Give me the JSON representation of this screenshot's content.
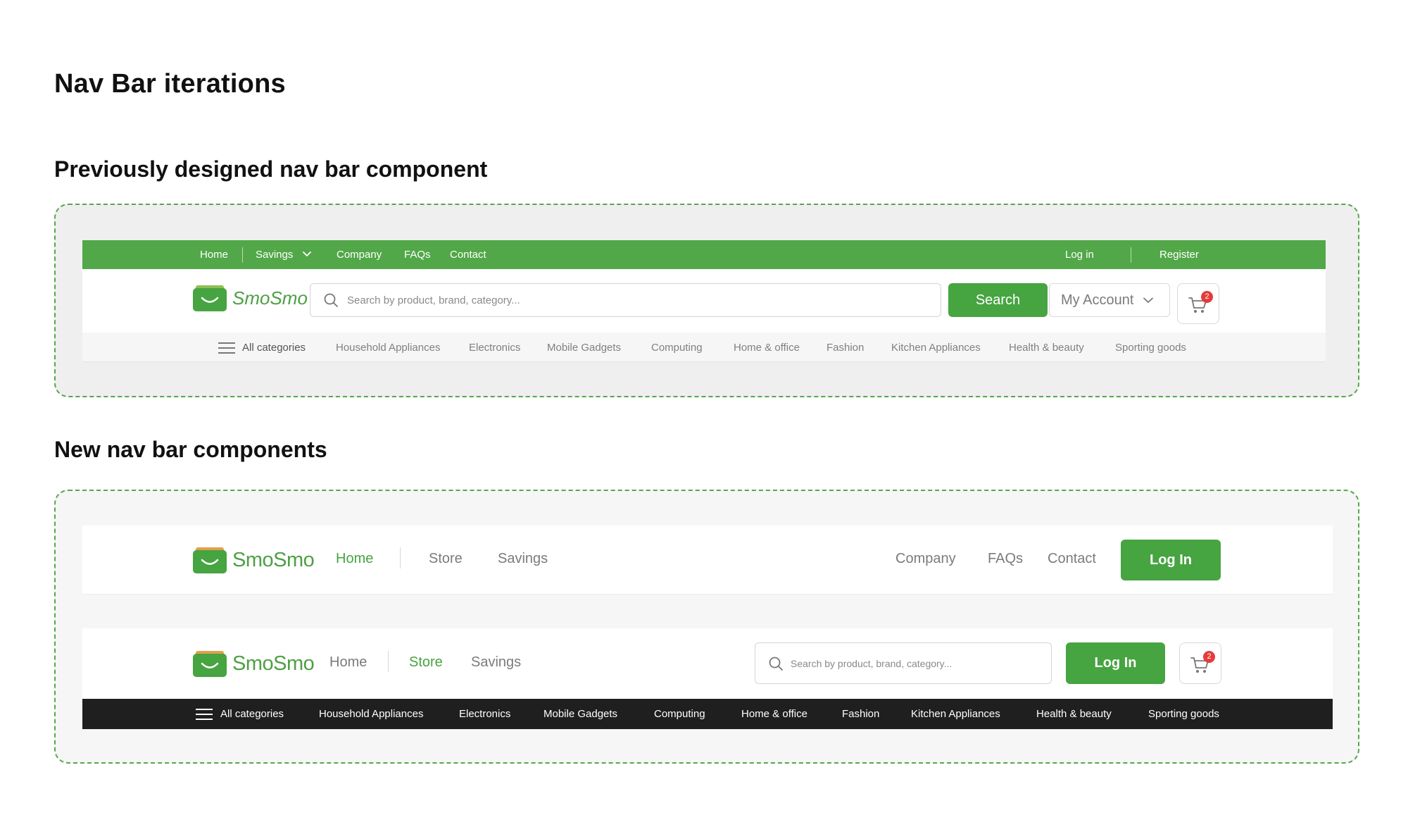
{
  "page": {
    "title": "Nav Bar iterations",
    "section_old": "Previously designed nav bar component",
    "section_new": "New nav bar components"
  },
  "brand": {
    "name": "SmoSmo",
    "color": "#46a441"
  },
  "old_nav": {
    "top_links": [
      "Home",
      "Savings",
      "Company",
      "FAQs",
      "Contact"
    ],
    "login": "Log in",
    "register": "Register",
    "search_placeholder": "Search by product, brand, category...",
    "search_button": "Search",
    "account": "My Account",
    "cart_count": "2",
    "all_categories": "All categories",
    "categories": [
      "Household Appliances",
      "Electronics",
      "Mobile Gadgets",
      "Computing",
      "Home & office",
      "Fashion",
      "Kitchen Appliances",
      "Health & beauty",
      "Sporting goods"
    ]
  },
  "new_nav_a": {
    "left_links": [
      "Home",
      "Store",
      "Savings"
    ],
    "active": "Home",
    "right_links": [
      "Company",
      "FAQs",
      "Contact"
    ],
    "login": "Log In"
  },
  "new_nav_b": {
    "left_links": [
      "Home",
      "Store",
      "Savings"
    ],
    "active": "Store",
    "search_placeholder": "Search by product, brand, category...",
    "login": "Log In",
    "cart_count": "2",
    "all_categories": "All categories",
    "categories": [
      "Household Appliances",
      "Electronics",
      "Mobile Gadgets",
      "Computing",
      "Home & office",
      "Fashion",
      "Kitchen Appliances",
      "Health & beauty",
      "Sporting goods"
    ]
  },
  "colors": {
    "green": "#46a441",
    "top_bar_green": "#52a748",
    "badge_red": "#e53b3b",
    "dark_bar": "#1f1f1f"
  }
}
